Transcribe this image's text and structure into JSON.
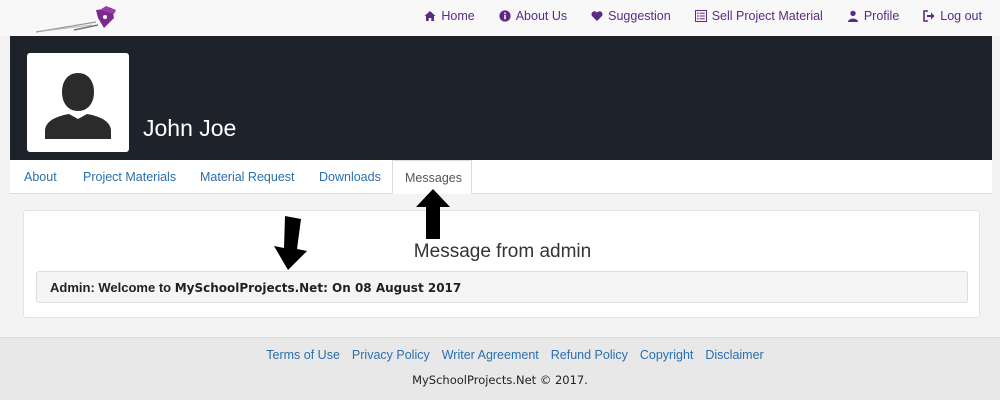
{
  "nav": {
    "items": [
      {
        "label": "Home",
        "icon": "home-icon"
      },
      {
        "label": "About Us",
        "icon": "info-icon"
      },
      {
        "label": "Suggestion",
        "icon": "heart-icon"
      },
      {
        "label": "Sell Project Material",
        "icon": "list-icon"
      },
      {
        "label": "Profile",
        "icon": "user-icon"
      },
      {
        "label": "Log out",
        "icon": "logout-icon"
      }
    ]
  },
  "profile": {
    "name": "John Joe"
  },
  "tabs": [
    {
      "label": "About",
      "active": false
    },
    {
      "label": "Project Materials",
      "active": false
    },
    {
      "label": "Material Request",
      "active": false
    },
    {
      "label": "Downloads",
      "active": false
    },
    {
      "label": "Messages",
      "active": true
    }
  ],
  "messages": {
    "title": "Message from admin",
    "items": [
      {
        "prefix": "Admin: Welcome to ",
        "site": "MySchoolProjects.Net",
        "suffix": ": On 08 August 2017"
      }
    ]
  },
  "footer": {
    "links": [
      "Terms of Use",
      "Privacy Policy",
      "Writer Agreement",
      "Refund Policy",
      "Copyright",
      "Disclaimer"
    ],
    "copyright": "MySchoolProjects.Net © 2017."
  },
  "colors": {
    "accent": "#5b2a86",
    "link": "#2a6fb0",
    "banner": "#1e232b"
  }
}
